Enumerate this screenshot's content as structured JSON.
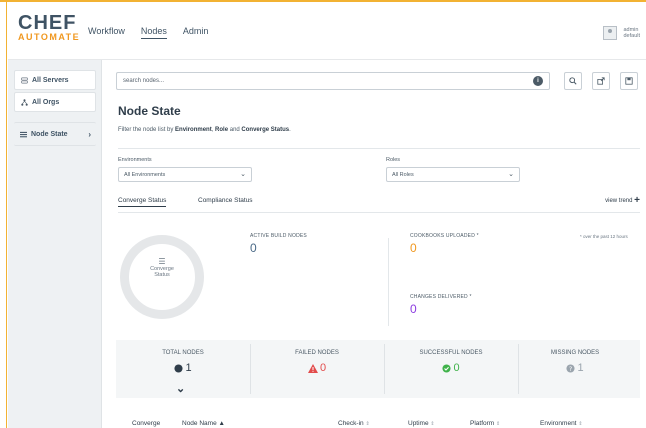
{
  "brand": {
    "name": "CHEF",
    "product": "AUTOMATE"
  },
  "topnav": [
    "Workflow",
    "Nodes",
    "Admin"
  ],
  "user": {
    "line1": "admin",
    "line2": "default"
  },
  "sidebar": {
    "items": [
      {
        "label": "All Servers",
        "icon": "server-icon"
      },
      {
        "label": "All Orgs",
        "icon": "org-icon"
      },
      {
        "label": "Node State",
        "icon": "list-icon"
      }
    ]
  },
  "search": {
    "placeholder": "search nodes...",
    "info": "i"
  },
  "toolbar": {
    "icons": [
      "search-icon",
      "share-icon",
      "save-icon"
    ]
  },
  "page": {
    "title": "Node State",
    "desc_prefix": "Filter the node list by ",
    "desc_b1": "Environment",
    "desc_sep1": ", ",
    "desc_b2": "Role",
    "desc_sep2": " and ",
    "desc_b3": "Converge Status",
    "desc_suffix": "."
  },
  "filters": {
    "environments_label": "Environments",
    "environments_value": "All Environments",
    "roles_label": "Roles",
    "roles_value": "All Roles"
  },
  "tabs": [
    "Converge Status",
    "Compliance Status"
  ],
  "view_trend": "view trend",
  "donut": {
    "line1": "Converge",
    "line2": "Status"
  },
  "metrics": {
    "active_build_label": "ACTIVE BUILD NODES",
    "active_build_value": "0",
    "cookbooks_label": "COOKBOOKS UPLOADED *",
    "cookbooks_value": "0",
    "changes_label": "CHANGES DELIVERED *",
    "changes_value": "0",
    "footnote": "* over the past 12 hours"
  },
  "cards": [
    {
      "label": "TOTAL NODES",
      "value": "1"
    },
    {
      "label": "FAILED NODES",
      "value": "0"
    },
    {
      "label": "SUCCESSFUL NODES",
      "value": "0"
    },
    {
      "label": "MISSING NODES",
      "value": "1"
    }
  ],
  "table_headers": [
    "Converge",
    "Node Name",
    "Check-in",
    "Uptime",
    "Platform",
    "Environment"
  ],
  "colors": {
    "accent": "#f2b233",
    "orange": "#f09820",
    "purple": "#8c3ce0",
    "blue_value": "#4b6a87",
    "failed": "#e24c4c",
    "success": "#3fb24a"
  }
}
